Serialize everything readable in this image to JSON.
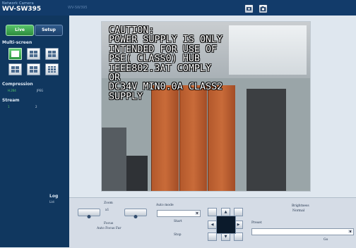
{
  "header": {
    "brand_top": "Network Camera",
    "brand_model": "WV-SW395",
    "camera_title": "WV-SW395"
  },
  "icons": {
    "snapshot": "camera-icon",
    "settings": "camera-settings-icon"
  },
  "sidebar": {
    "tabs": [
      {
        "label": "Live"
      },
      {
        "label": "Setup"
      }
    ],
    "multi_screen_label": "Multi-screen",
    "compression_label": "Compression",
    "compression_options": [
      "H.264",
      "JPEG"
    ],
    "stream_label": "Stream",
    "stream_options": [
      "1",
      "2"
    ],
    "log_label": "Log",
    "log_link": "List"
  },
  "camera": {
    "overlay_text": "CAUTION:\nPOWER SUPPLY IS ONLY\nINTENDED FOR USE OF\nPSE( CLASS0) HUB\nIEEE802.3AT COMPLY\nOR\nDC34V MIN0.0A CLASS2\nSUPPLY"
  },
  "controls": {
    "zoom_label": "Zoom",
    "zoom_value": "x1",
    "focus_label": "Focus",
    "auto_focus_label": "Auto Focus Far",
    "auto_mode_label": "Auto mode",
    "start_label": "Start",
    "stop_label": "Stop",
    "brightness_label": "Brightness",
    "brightness_value": "Normal",
    "preset_label": "Preset",
    "go_label": "Go",
    "arrows": {
      "up": "▲",
      "down": "▼",
      "left": "◀",
      "right": "▶"
    }
  }
}
